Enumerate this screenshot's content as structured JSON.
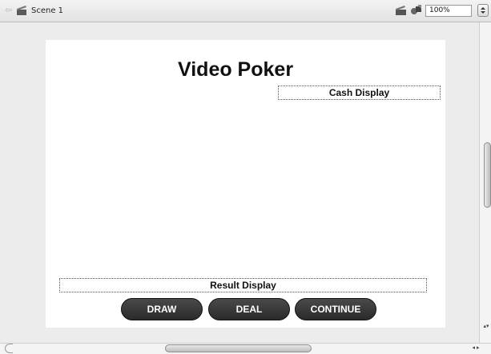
{
  "toolbar": {
    "back_icon": "back-arrow-icon",
    "scene_icon": "clapperboard-icon",
    "scene_label": "Scene 1",
    "edit_scene_icon": "edit-scene-icon",
    "edit_symbol_icon": "edit-symbol-icon",
    "zoom_value": "100%",
    "zoom_dropdown_icon": "dropdown-arrows-icon"
  },
  "stage": {
    "title": "Video Poker",
    "cash_display": "Cash Display",
    "result_display": "Result Display",
    "buttons": {
      "draw": "DRAW",
      "deal": "DEAL",
      "continue": "CONTINUE"
    }
  },
  "scrollbars": {
    "vertical_arrows": "▴▾",
    "horizontal_arrows": "◂ ▸"
  },
  "colors": {
    "stage_background": "#ffffff",
    "pasteboard": "#ececec",
    "button_fill": "#333333",
    "button_text": "#ffffff"
  }
}
